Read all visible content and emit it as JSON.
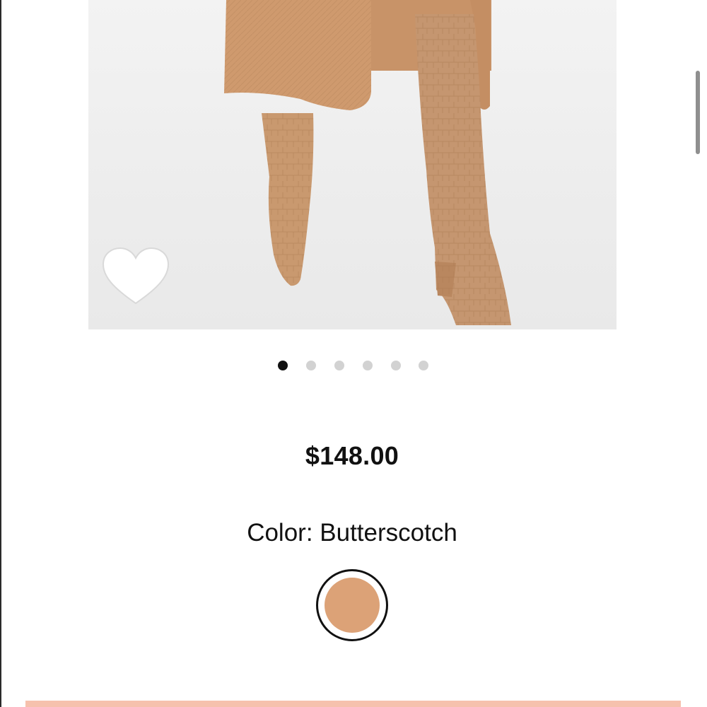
{
  "product": {
    "price": "$148.00",
    "color_text": "Color: Butterscotch",
    "color_swatch_hex": "#dca277"
  },
  "gallery": {
    "image_subject": "knee-high croc-embossed heeled boots",
    "total_images": 6,
    "active_index": 0
  },
  "icons": {
    "favorite": "heart-icon"
  },
  "colors": {
    "dot_active": "#111111",
    "dot_inactive": "#d2d2d2",
    "cta_bar": "#f6c1ad"
  }
}
